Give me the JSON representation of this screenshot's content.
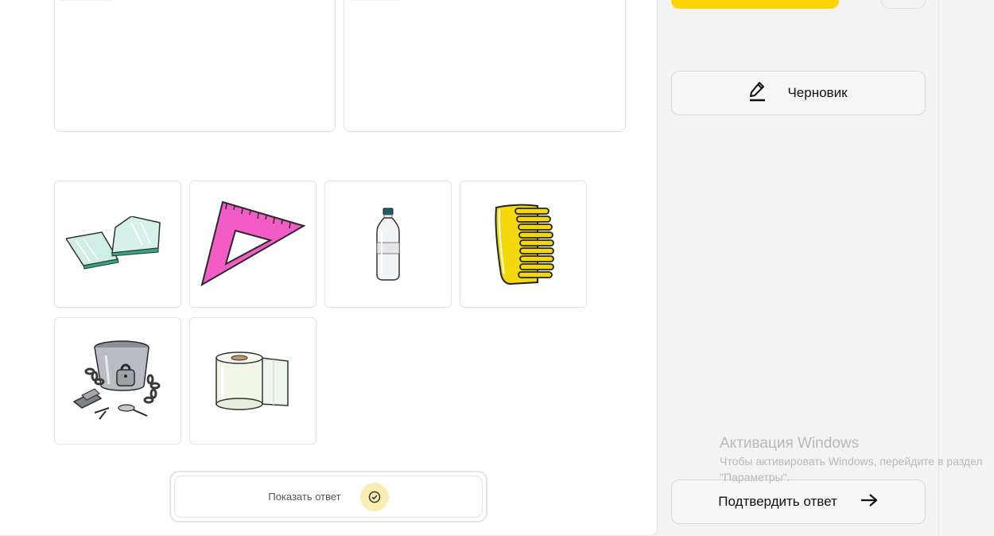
{
  "draft": {
    "label": "Черновик",
    "icon": "pencil-icon"
  },
  "show_answer": {
    "label": "Показать ответ",
    "icon": "check-circle-icon"
  },
  "confirm": {
    "label": "Подтвердить ответ",
    "icon": "arrow-right-icon"
  },
  "cards": [
    {
      "name": "glass-plates-image"
    },
    {
      "name": "triangle-ruler-image"
    },
    {
      "name": "plastic-bottle-image"
    },
    {
      "name": "yellow-comb-image"
    },
    {
      "name": "metal-items-image"
    },
    {
      "name": "paper-towel-roll-image"
    }
  ],
  "watermark": {
    "title": "Активация Windows",
    "body": "Чтобы активировать Windows, перейдите в раздел \"Параметры\"."
  },
  "colors": {
    "accent": "#ffd400",
    "check_bg": "#fbeeb5",
    "triangle": "#f25cc6",
    "comb": "#f5d80b"
  }
}
